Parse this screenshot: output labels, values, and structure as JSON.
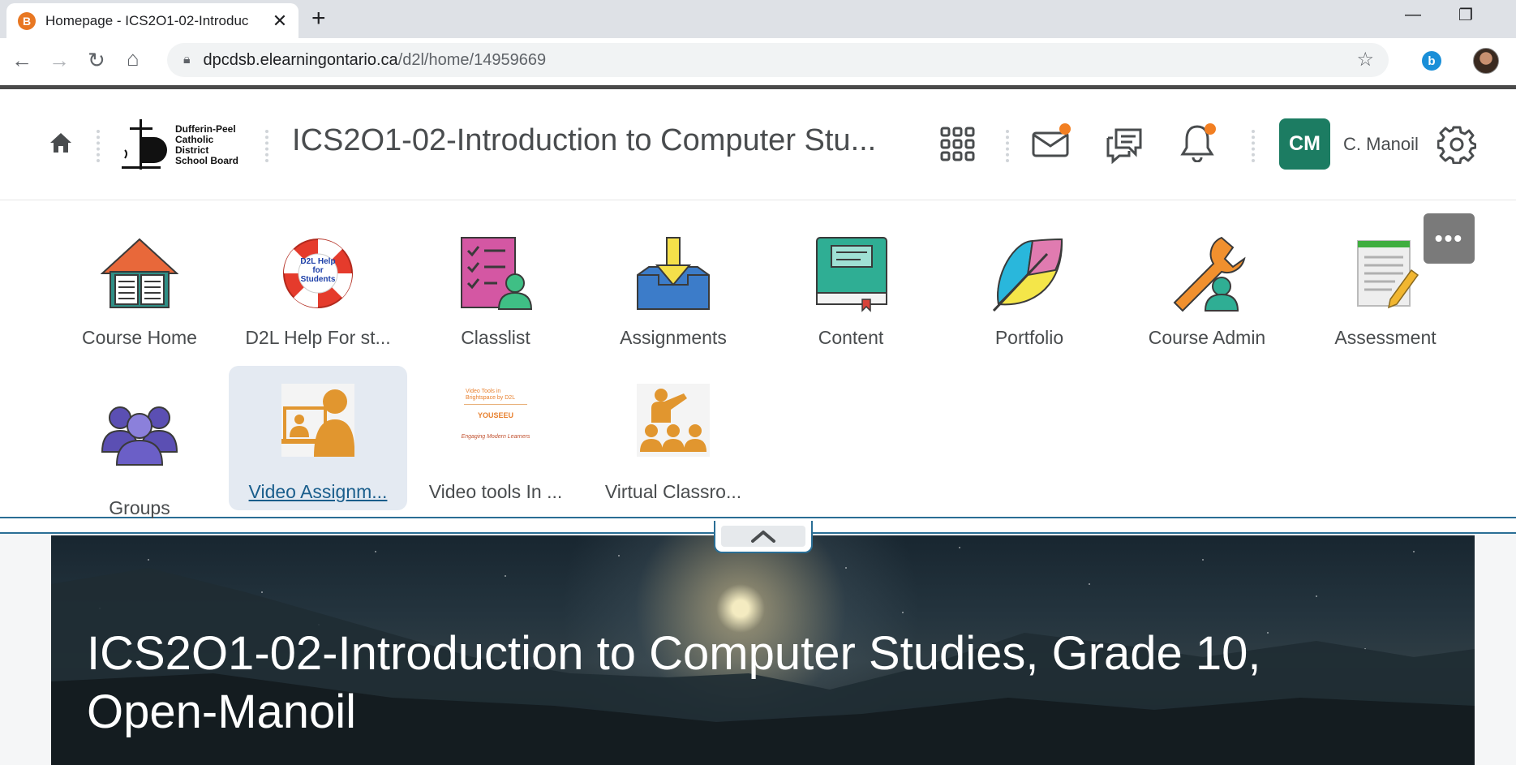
{
  "browser": {
    "tab_title": "Homepage - ICS2O1-02-Introduc",
    "favicon_letter": "B",
    "url_host": "dpcdsb.elearningontario.ca",
    "url_path": "/d2l/home/14959669",
    "extension_letter": "b"
  },
  "header": {
    "logo_text_line1": "Dufferin-Peel",
    "logo_text_line2": "Catholic District",
    "logo_text_line3": "School Board",
    "course_title": "ICS2O1-02-Introduction to Computer Stu...",
    "avatar_initials": "CM",
    "user_name": "C. Manoil",
    "avatar_color": "#1c7c62",
    "badge_color": "#f27f22"
  },
  "navbar": {
    "more_label": "•••",
    "tiles": [
      {
        "label": "Course Home",
        "icon": "course-home-icon"
      },
      {
        "label": "D2L Help For st...",
        "icon": "help-lifebuoy-icon"
      },
      {
        "label": "Classlist",
        "icon": "classlist-icon"
      },
      {
        "label": "Assignments",
        "icon": "assignments-inbox-icon"
      },
      {
        "label": "Content",
        "icon": "content-book-icon"
      },
      {
        "label": "Portfolio",
        "icon": "portfolio-leaf-icon"
      },
      {
        "label": "Course Admin",
        "icon": "course-admin-wrench-icon"
      },
      {
        "label": "Assessment",
        "icon": "assessment-icon"
      },
      {
        "label": "Groups",
        "icon": "groups-icon"
      },
      {
        "label": "Video Assignm...",
        "icon": "video-assignment-icon"
      },
      {
        "label": "Video tools In ...",
        "icon": "video-tools-thumbnail-icon"
      },
      {
        "label": "Virtual Classro...",
        "icon": "virtual-classroom-icon"
      }
    ],
    "help_icon_text": "D2L Help for Students",
    "video_tools_text_top": "Video Tools in Brightspace by D2L",
    "video_tools_text_mid": "YOUSEEU",
    "video_tools_text_bottom": "Engaging Modern Learners"
  },
  "banner": {
    "title": "ICS2O1-02-Introduction to Computer Studies, Grade 10, Open-Manoil"
  }
}
